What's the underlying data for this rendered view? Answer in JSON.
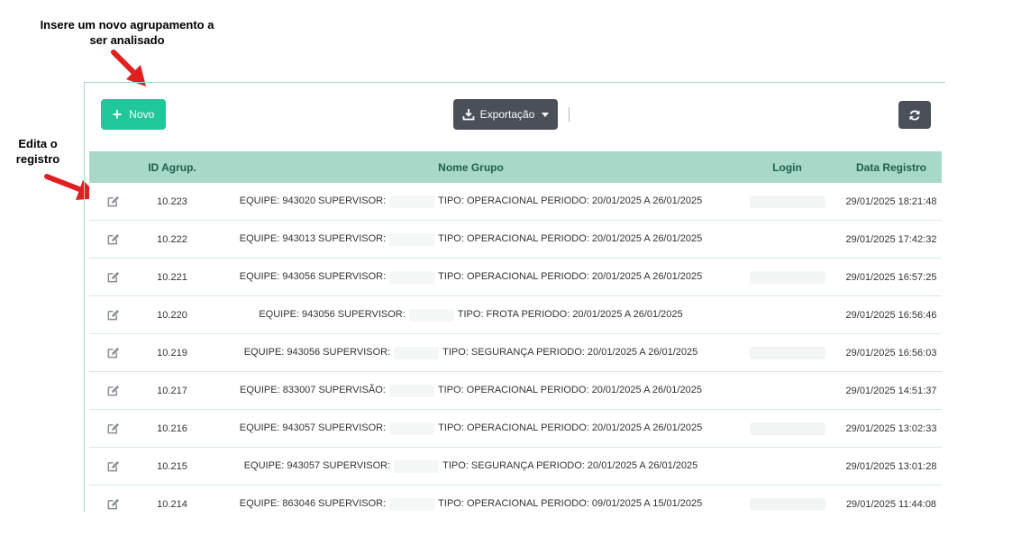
{
  "annotations": {
    "novo_note": "Insere um novo agrupamento a ser analisado",
    "edit_note": "Edita o registro"
  },
  "toolbar": {
    "novo_label": "Novo",
    "export_label": "Exportação"
  },
  "table": {
    "columns": [
      "",
      "ID Agrup.",
      "Nome Grupo",
      "Login",
      "Data Registro"
    ],
    "rows": [
      {
        "id": "10.223",
        "equipe": "EQUIPE: 943020 SUPERVISOR:",
        "tipo": "TIPO: OPERACIONAL PERIODO: 20/01/2025 A 26/01/2025",
        "data": "29/01/2025 18:21:48"
      },
      {
        "id": "10.222",
        "equipe": "EQUIPE: 943013 SUPERVISOR:",
        "tipo": "TIPO: OPERACIONAL PERIODO: 20/01/2025 A 26/01/2025",
        "data": "29/01/2025 17:42:32"
      },
      {
        "id": "10.221",
        "equipe": "EQUIPE: 943056 SUPERVISOR:",
        "tipo": "TIPO: OPERACIONAL PERIODO: 20/01/2025 A 26/01/2025",
        "data": "29/01/2025 16:57:25"
      },
      {
        "id": "10.220",
        "equipe": "EQUIPE: 943056 SUPERVISOR:",
        "tipo": "TIPO: FROTA PERIODO: 20/01/2025 A 26/01/2025",
        "data": "29/01/2025 16:56:46"
      },
      {
        "id": "10.219",
        "equipe": "EQUIPE: 943056 SUPERVISOR:",
        "tipo": "TIPO: SEGURANÇA PERIODO: 20/01/2025 A 26/01/2025",
        "data": "29/01/2025 16:56:03"
      },
      {
        "id": "10.217",
        "equipe": "EQUIPE: 833007 SUPERVISÃO:",
        "tipo": "TIPO: OPERACIONAL PERIODO: 20/01/2025 A 26/01/2025",
        "data": "29/01/2025 14:51:37"
      },
      {
        "id": "10.216",
        "equipe": "EQUIPE: 943057 SUPERVISOR:",
        "tipo": "TIPO: OPERACIONAL PERIODO: 20/01/2025 A 26/01/2025",
        "data": "29/01/2025 13:02:33"
      },
      {
        "id": "10.215",
        "equipe": "EQUIPE: 943057 SUPERVISOR:",
        "tipo": "TIPO: SEGURANÇA PERIODO: 20/01/2025 A 26/01/2025",
        "data": "29/01/2025 13:01:28"
      },
      {
        "id": "10.214",
        "equipe": "EQUIPE: 863046 SUPERVISOR:",
        "tipo": "TIPO: OPERACIONAL PERIODO: 09/01/2025 A 15/01/2025",
        "data": "29/01/2025 11:44:08"
      }
    ]
  },
  "colors": {
    "accent": "#1fc79a",
    "header_bg": "#a8d8c8",
    "header_text": "#1e5f4e",
    "dark_button": "#4a4f58",
    "annotation_arrow": "#e02020"
  },
  "icons": {
    "novo": "plus-icon",
    "export": "download-icon",
    "export_caret": "caret-down-icon",
    "refresh": "refresh-icon",
    "edit": "edit-icon"
  }
}
